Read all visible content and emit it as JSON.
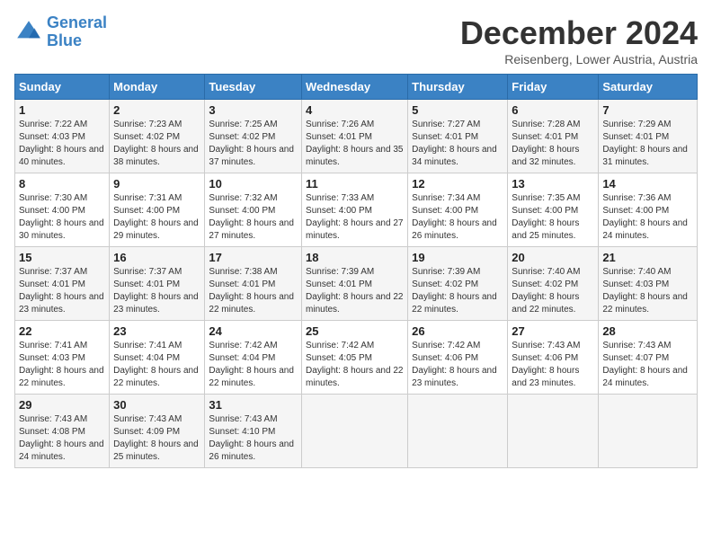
{
  "header": {
    "logo_line1": "General",
    "logo_line2": "Blue",
    "month_title": "December 2024",
    "location": "Reisenberg, Lower Austria, Austria"
  },
  "weekdays": [
    "Sunday",
    "Monday",
    "Tuesday",
    "Wednesday",
    "Thursday",
    "Friday",
    "Saturday"
  ],
  "weeks": [
    [
      {
        "day": "1",
        "sunrise": "7:22 AM",
        "sunset": "4:03 PM",
        "daylight": "8 hours and 40 minutes."
      },
      {
        "day": "2",
        "sunrise": "7:23 AM",
        "sunset": "4:02 PM",
        "daylight": "8 hours and 38 minutes."
      },
      {
        "day": "3",
        "sunrise": "7:25 AM",
        "sunset": "4:02 PM",
        "daylight": "8 hours and 37 minutes."
      },
      {
        "day": "4",
        "sunrise": "7:26 AM",
        "sunset": "4:01 PM",
        "daylight": "8 hours and 35 minutes."
      },
      {
        "day": "5",
        "sunrise": "7:27 AM",
        "sunset": "4:01 PM",
        "daylight": "8 hours and 34 minutes."
      },
      {
        "day": "6",
        "sunrise": "7:28 AM",
        "sunset": "4:01 PM",
        "daylight": "8 hours and 32 minutes."
      },
      {
        "day": "7",
        "sunrise": "7:29 AM",
        "sunset": "4:01 PM",
        "daylight": "8 hours and 31 minutes."
      }
    ],
    [
      {
        "day": "8",
        "sunrise": "7:30 AM",
        "sunset": "4:00 PM",
        "daylight": "8 hours and 30 minutes."
      },
      {
        "day": "9",
        "sunrise": "7:31 AM",
        "sunset": "4:00 PM",
        "daylight": "8 hours and 29 minutes."
      },
      {
        "day": "10",
        "sunrise": "7:32 AM",
        "sunset": "4:00 PM",
        "daylight": "8 hours and 27 minutes."
      },
      {
        "day": "11",
        "sunrise": "7:33 AM",
        "sunset": "4:00 PM",
        "daylight": "8 hours and 27 minutes."
      },
      {
        "day": "12",
        "sunrise": "7:34 AM",
        "sunset": "4:00 PM",
        "daylight": "8 hours and 26 minutes."
      },
      {
        "day": "13",
        "sunrise": "7:35 AM",
        "sunset": "4:00 PM",
        "daylight": "8 hours and 25 minutes."
      },
      {
        "day": "14",
        "sunrise": "7:36 AM",
        "sunset": "4:00 PM",
        "daylight": "8 hours and 24 minutes."
      }
    ],
    [
      {
        "day": "15",
        "sunrise": "7:37 AM",
        "sunset": "4:01 PM",
        "daylight": "8 hours and 23 minutes."
      },
      {
        "day": "16",
        "sunrise": "7:37 AM",
        "sunset": "4:01 PM",
        "daylight": "8 hours and 23 minutes."
      },
      {
        "day": "17",
        "sunrise": "7:38 AM",
        "sunset": "4:01 PM",
        "daylight": "8 hours and 22 minutes."
      },
      {
        "day": "18",
        "sunrise": "7:39 AM",
        "sunset": "4:01 PM",
        "daylight": "8 hours and 22 minutes."
      },
      {
        "day": "19",
        "sunrise": "7:39 AM",
        "sunset": "4:02 PM",
        "daylight": "8 hours and 22 minutes."
      },
      {
        "day": "20",
        "sunrise": "7:40 AM",
        "sunset": "4:02 PM",
        "daylight": "8 hours and 22 minutes."
      },
      {
        "day": "21",
        "sunrise": "7:40 AM",
        "sunset": "4:03 PM",
        "daylight": "8 hours and 22 minutes."
      }
    ],
    [
      {
        "day": "22",
        "sunrise": "7:41 AM",
        "sunset": "4:03 PM",
        "daylight": "8 hours and 22 minutes."
      },
      {
        "day": "23",
        "sunrise": "7:41 AM",
        "sunset": "4:04 PM",
        "daylight": "8 hours and 22 minutes."
      },
      {
        "day": "24",
        "sunrise": "7:42 AM",
        "sunset": "4:04 PM",
        "daylight": "8 hours and 22 minutes."
      },
      {
        "day": "25",
        "sunrise": "7:42 AM",
        "sunset": "4:05 PM",
        "daylight": "8 hours and 22 minutes."
      },
      {
        "day": "26",
        "sunrise": "7:42 AM",
        "sunset": "4:06 PM",
        "daylight": "8 hours and 23 minutes."
      },
      {
        "day": "27",
        "sunrise": "7:43 AM",
        "sunset": "4:06 PM",
        "daylight": "8 hours and 23 minutes."
      },
      {
        "day": "28",
        "sunrise": "7:43 AM",
        "sunset": "4:07 PM",
        "daylight": "8 hours and 24 minutes."
      }
    ],
    [
      {
        "day": "29",
        "sunrise": "7:43 AM",
        "sunset": "4:08 PM",
        "daylight": "8 hours and 24 minutes."
      },
      {
        "day": "30",
        "sunrise": "7:43 AM",
        "sunset": "4:09 PM",
        "daylight": "8 hours and 25 minutes."
      },
      {
        "day": "31",
        "sunrise": "7:43 AM",
        "sunset": "4:10 PM",
        "daylight": "8 hours and 26 minutes."
      },
      null,
      null,
      null,
      null
    ]
  ]
}
